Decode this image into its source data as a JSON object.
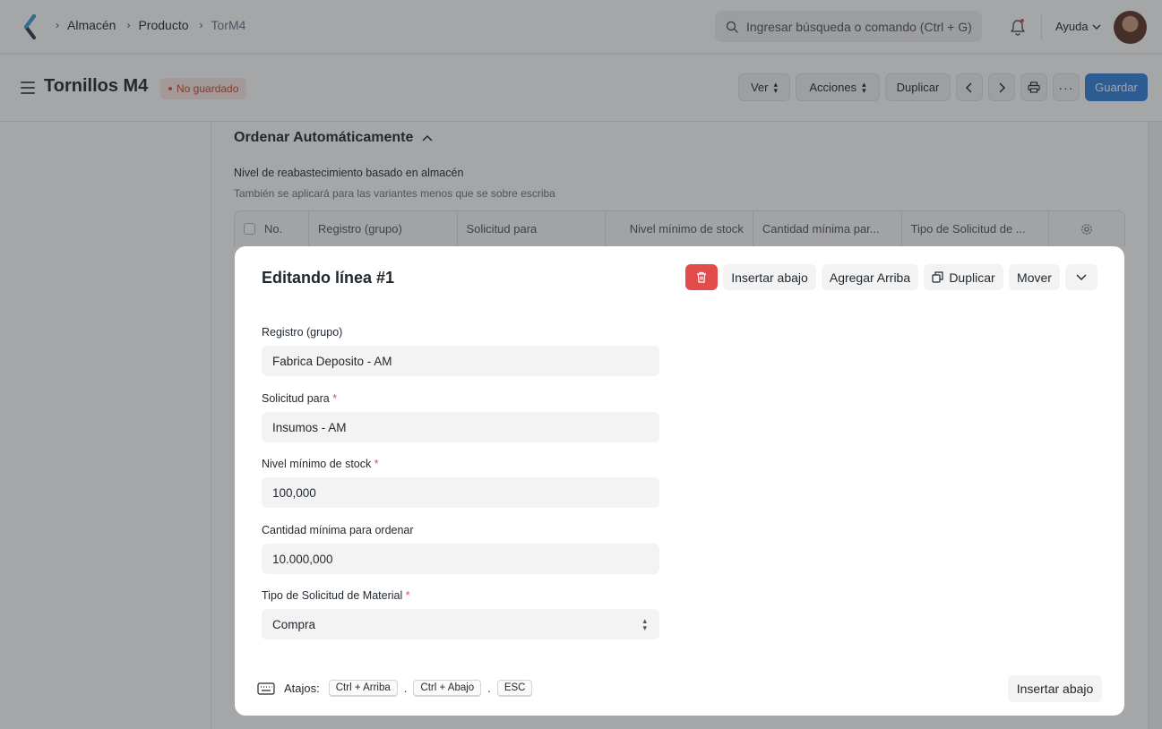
{
  "navbar": {
    "breadcrumbs": [
      "Almacén",
      "Producto",
      "TorM4"
    ],
    "search_placeholder": "Ingresar búsqueda o comando (Ctrl + G)",
    "help_label": "Ayuda"
  },
  "page": {
    "title": "Tornillos M4",
    "status_badge": "No guardado",
    "buttons": {
      "ver": "Ver",
      "acciones": "Acciones",
      "duplicar": "Duplicar",
      "guardar": "Guardar"
    }
  },
  "section": {
    "title": "Ordenar Automáticamente",
    "description": "Nivel de reabastecimiento basado en almacén",
    "note": "También se aplicará para las variantes menos que se sobre escriba",
    "columns": [
      "No.",
      "Registro (grupo)",
      "Solicitud para",
      "Nivel mínimo de stock",
      "Cantidad mínima par...",
      "Tipo de Solicitud de ..."
    ]
  },
  "modal": {
    "title": "Editando línea #1",
    "buttons": {
      "insert_below": "Insertar abajo",
      "add_above": "Agregar Arriba",
      "duplicate": "Duplicar",
      "move": "Mover"
    },
    "fields": [
      {
        "label": "Registro (grupo)",
        "value": "Fabrica Deposito - AM",
        "required": ""
      },
      {
        "label": "Solicitud para",
        "value": "Insumos - AM",
        "required": "*"
      },
      {
        "label": "Nivel mínimo de stock",
        "value": "100,000",
        "required": "*"
      },
      {
        "label": "Cantidad mínima para ordenar",
        "value": "10.000,000",
        "required": ""
      },
      {
        "label": "Tipo de Solicitud de Material",
        "value": "Compra",
        "required": "*"
      }
    ],
    "shortcuts_label": "Atajos:",
    "shortcut_keys": [
      "Ctrl + Arriba",
      "Ctrl + Abajo",
      "ESC"
    ],
    "shortcut_sep": ".",
    "footer_insert_below": "Insertar abajo"
  },
  "colors": {
    "primary": "#2f80d8",
    "danger": "#e24c4c",
    "badge_text": "#c2492d"
  }
}
